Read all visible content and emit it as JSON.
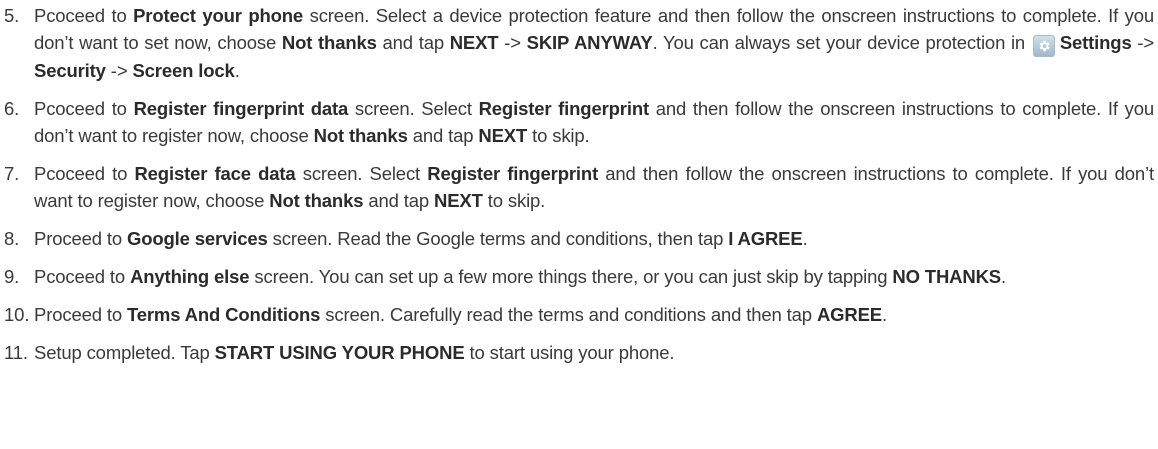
{
  "steps": [
    {
      "number": "5.",
      "segments": [
        {
          "t": "Pcoceed to "
        },
        {
          "t": "Protect your phone",
          "b": true
        },
        {
          "t": " screen. Select a device protection feature and then follow the onscreen instructions to complete. If you don’t want to set now, choose "
        },
        {
          "t": "Not thanks",
          "b": true
        },
        {
          "t": " and tap "
        },
        {
          "t": "NEXT",
          "b": true
        },
        {
          "t": " -> "
        },
        {
          "t": "SKIP ANYWAY",
          "b": true
        },
        {
          "t": ". You can always set your device protection in "
        },
        {
          "icon": "settings-gear-icon"
        },
        {
          "t": "Settings",
          "b": true
        },
        {
          "t": " -> "
        },
        {
          "t": "Security",
          "b": true
        },
        {
          "t": " -> "
        },
        {
          "t": "Screen lock",
          "b": true
        },
        {
          "t": "."
        }
      ]
    },
    {
      "number": "6.",
      "segments": [
        {
          "t": "Pcoceed to "
        },
        {
          "t": "Register fingerprint data",
          "b": true
        },
        {
          "t": " screen. Select "
        },
        {
          "t": "Register fingerprint",
          "b": true
        },
        {
          "t": " and then follow the onscreen instructions to complete. If you don’t want to register now, choose "
        },
        {
          "t": "Not thanks",
          "b": true
        },
        {
          "t": " and tap "
        },
        {
          "t": "NEXT",
          "b": true
        },
        {
          "t": " to skip."
        }
      ]
    },
    {
      "number": "7.",
      "segments": [
        {
          "t": "Pcoceed to "
        },
        {
          "t": "Register face data",
          "b": true
        },
        {
          "t": " screen. Select "
        },
        {
          "t": "Register fingerprint",
          "b": true
        },
        {
          "t": " and then follow the onscreen instructions to complete. If you don’t want to register now, choose "
        },
        {
          "t": "Not thanks",
          "b": true
        },
        {
          "t": " and tap "
        },
        {
          "t": "NEXT",
          "b": true
        },
        {
          "t": " to skip."
        }
      ]
    },
    {
      "number": "8.",
      "segments": [
        {
          "t": "Proceed to "
        },
        {
          "t": "Google services",
          "b": true
        },
        {
          "t": " screen. Read the Google terms and conditions, then tap "
        },
        {
          "t": "I AGREE",
          "b": true
        },
        {
          "t": "."
        }
      ]
    },
    {
      "number": "9.",
      "segments": [
        {
          "t": "Pcoceed to "
        },
        {
          "t": "Anything else",
          "b": true
        },
        {
          "t": " screen. You can set up a few more things there, or you can just skip by tapping "
        },
        {
          "t": "NO THANKS",
          "b": true
        },
        {
          "t": "."
        }
      ]
    },
    {
      "number": "10.",
      "segments": [
        {
          "t": "Proceed to "
        },
        {
          "t": "Terms And Conditions",
          "b": true
        },
        {
          "t": " screen. Carefully read the terms and conditions and then tap "
        },
        {
          "t": "AGREE",
          "b": true
        },
        {
          "t": "."
        }
      ]
    },
    {
      "number": "11.",
      "segments": [
        {
          "t": "Setup completed. Tap "
        },
        {
          "t": "START USING YOUR PHONE",
          "b": true
        },
        {
          "t": " to start using your phone."
        }
      ]
    }
  ]
}
